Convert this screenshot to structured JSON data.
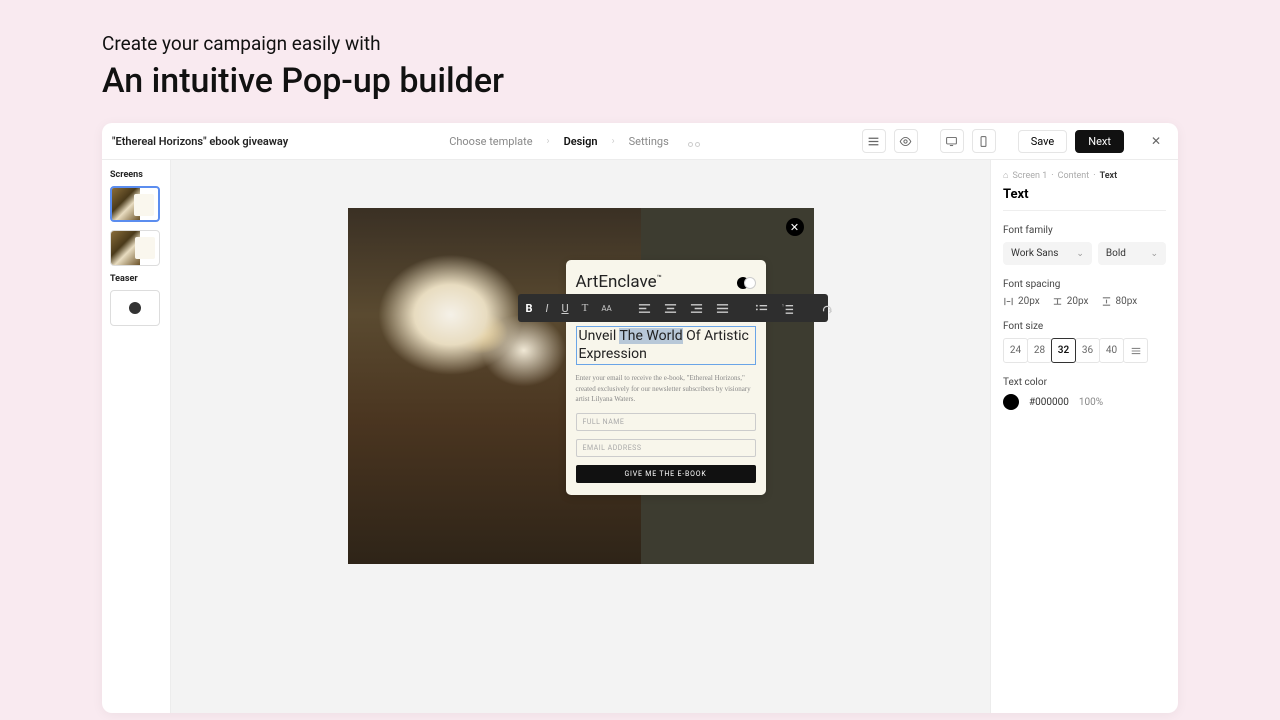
{
  "hero": {
    "small": "Create your campaign easily with",
    "big": "An intuitive Pop-up builder"
  },
  "topbar": {
    "title": "\"Ethereal Horizons\" ebook giveaway",
    "steps": [
      "Choose template",
      "Design",
      "Settings"
    ],
    "save": "Save",
    "next": "Next"
  },
  "left": {
    "screens_label": "Screens",
    "teaser_label": "Teaser"
  },
  "popup": {
    "brand": "ArtEnclave",
    "headline_pre": "Unveil ",
    "headline_sel": "The World",
    "headline_post": " Of Artistic Expression",
    "desc": "Enter your email to receive the e-book, \"Ethereal Horizons,\" created exclusively for our newsletter subscribers by visionary artist Lilyana Waters.",
    "name_ph": "FULL NAME",
    "email_ph": "EMAIL ADDRESS",
    "cta": "GIVE ME THE E-BOOK"
  },
  "panel": {
    "crumb": [
      "Screen 1",
      "Content",
      "Text"
    ],
    "title": "Text",
    "font_family_label": "Font family",
    "font_family": "Work Sans",
    "font_weight": "Bold",
    "spacing_label": "Font spacing",
    "spacing": [
      "20px",
      "20px",
      "80px"
    ],
    "size_label": "Font size",
    "sizes": [
      "24",
      "28",
      "32",
      "36",
      "40"
    ],
    "size_active": "32",
    "color_label": "Text color",
    "hex": "#000000",
    "opacity": "100%"
  }
}
